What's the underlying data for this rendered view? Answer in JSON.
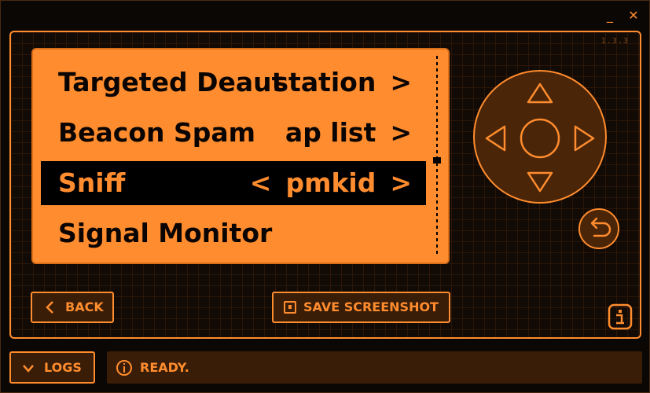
{
  "window": {
    "minimize_glyph": "_",
    "close_glyph": "✕"
  },
  "version": "1.3.3",
  "menu": {
    "items": [
      {
        "label": "Targeted Deaut",
        "value": "station",
        "left_arrow": "",
        "right_arrow": ">"
      },
      {
        "label": "Beacon Spam",
        "value": "ap list",
        "left_arrow": "",
        "right_arrow": ">"
      },
      {
        "label": "Sniff",
        "value": "pmkid",
        "left_arrow": "<",
        "right_arrow": ">",
        "selected": true
      },
      {
        "label": "Signal Monitor",
        "value": "",
        "left_arrow": "",
        "right_arrow": ""
      }
    ],
    "scroll_position": 0.5
  },
  "controls": {
    "dpad_icons": [
      "dpad-up-icon",
      "dpad-left-icon",
      "dpad-center-icon",
      "dpad-right-icon",
      "dpad-down-icon"
    ],
    "undo_icon": "undo-arrow-icon"
  },
  "buttons": {
    "back_label": "BACK",
    "save_screenshot_label": "SAVE SCREENSHOT",
    "logs_label": "LOGS"
  },
  "status": {
    "text": "READY."
  },
  "colors": {
    "accent": "#ff8c2e",
    "background": "#120a04",
    "panel_fill": "#3a1d07",
    "screen_text": "#0a0502"
  }
}
